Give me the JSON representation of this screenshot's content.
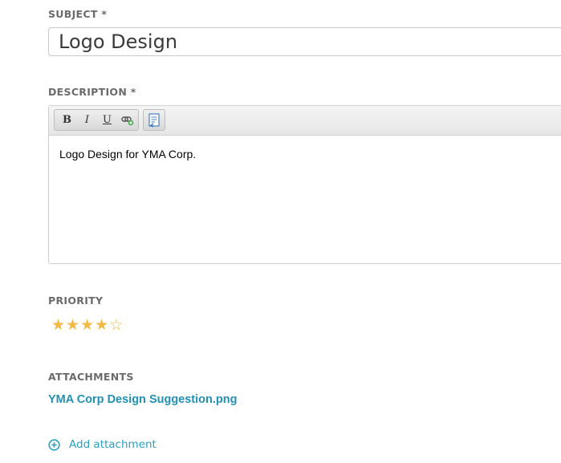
{
  "subject": {
    "label": "SUBJECT *",
    "value": "Logo Design"
  },
  "description": {
    "label": "DESCRIPTION *",
    "toolbar": {
      "bold": "B",
      "italic": "I",
      "underline": "U",
      "link_icon": "link-icon",
      "source_icon": "source-icon"
    },
    "content": "Logo Design for YMA Corp."
  },
  "priority": {
    "label": "PRIORITY",
    "rating": 4,
    "max": 5,
    "star_color": "#f4b942"
  },
  "attachments": {
    "label": "ATTACHMENTS",
    "files": [
      "YMA Corp Design Suggestion.png"
    ],
    "add_label": "Add attachment",
    "link_color": "#2290b5"
  }
}
